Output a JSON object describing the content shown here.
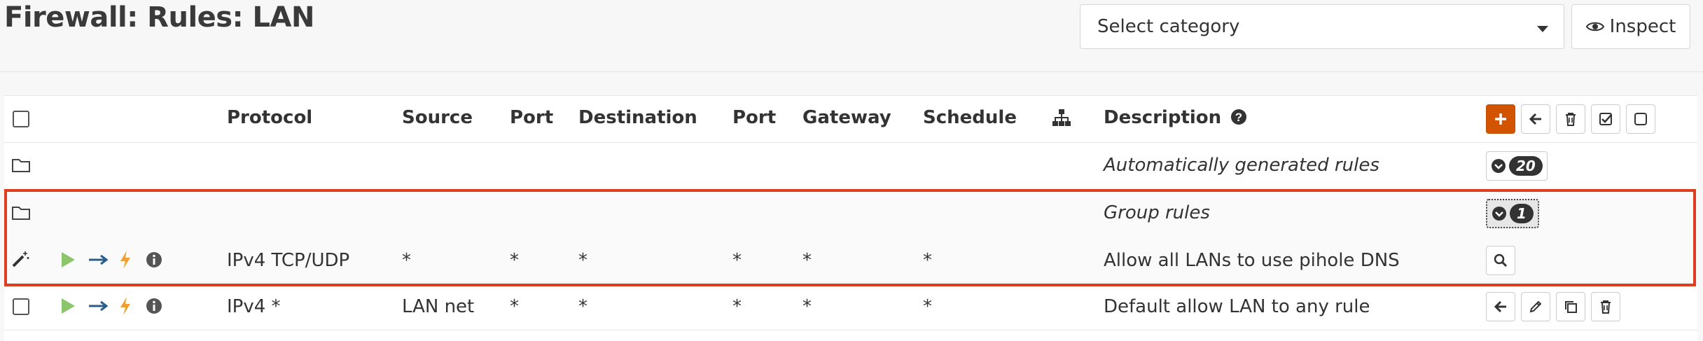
{
  "page": {
    "title": "Firewall: Rules: LAN"
  },
  "toolbar": {
    "category_placeholder": "Select category",
    "inspect_label": "Inspect"
  },
  "table": {
    "headers": {
      "protocol": "Protocol",
      "source": "Source",
      "port": "Port",
      "destination": "Destination",
      "dest_port": "Port",
      "gateway": "Gateway",
      "schedule": "Schedule",
      "description": "Description"
    },
    "groups": [
      {
        "description": "Automatically generated rules",
        "count": "20"
      },
      {
        "description": "Group rules",
        "count": "1"
      }
    ],
    "rules": [
      {
        "protocol": "IPv4 TCP/UDP",
        "source": "*",
        "port": "*",
        "destination": "*",
        "dest_port": "*",
        "gateway": "*",
        "schedule": "*",
        "description": "Allow all LANs to use pihole DNS"
      },
      {
        "protocol": "IPv4 *",
        "source": "LAN net",
        "port": "*",
        "destination": "*",
        "dest_port": "*",
        "gateway": "*",
        "schedule": "*",
        "description": "Default allow LAN to any rule"
      }
    ]
  },
  "colors": {
    "accent": "#d35400",
    "highlight": "#e03c1f",
    "pass": "#8cc56b",
    "direction": "#2a5d8a",
    "quick": "#f0a030"
  }
}
